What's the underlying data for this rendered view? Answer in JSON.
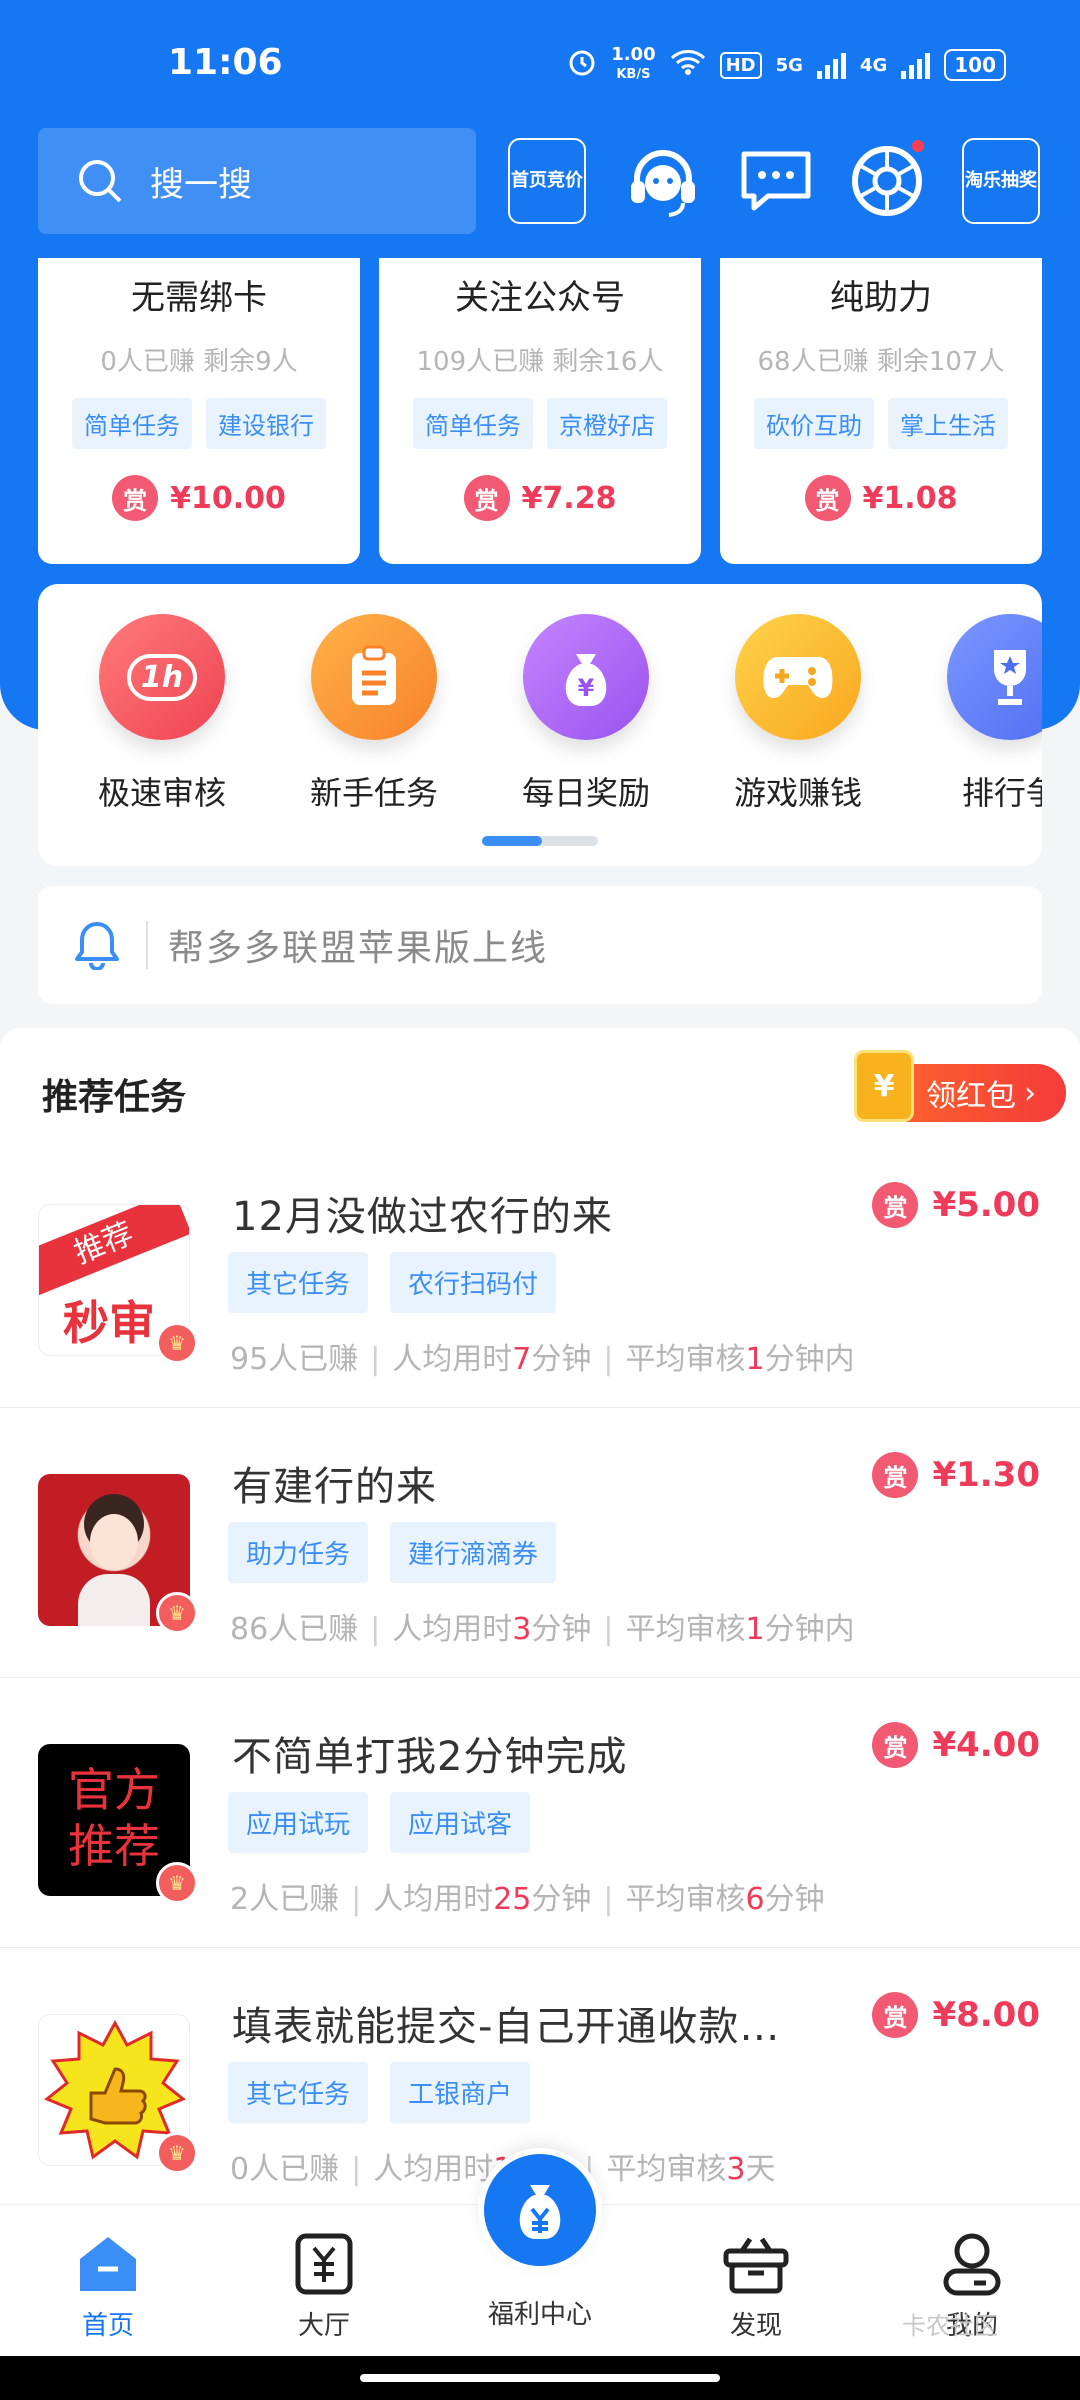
{
  "status_bar": {
    "time": "11:06",
    "speed_value": "1.00",
    "speed_unit": "KB/S",
    "hd": "HD",
    "net1": "5G",
    "net2": "4G",
    "battery": "100"
  },
  "header": {
    "search_placeholder": "搜一搜",
    "btn_home_bid": "首页竞价",
    "btn_lottery": "淘乐抽奖"
  },
  "top_cards": [
    {
      "title": "无需绑卡",
      "stats": "0人已赚  剩余9人",
      "tags": [
        "简单任务",
        "建设银行"
      ],
      "badge": "赏",
      "price": "¥10.00"
    },
    {
      "title": "关注公众号",
      "stats": "109人已赚  剩余16人",
      "tags": [
        "简单任务",
        "京橙好店"
      ],
      "badge": "赏",
      "price": "¥7.28"
    },
    {
      "title": "纯助力",
      "stats": "68人已赚  剩余107人",
      "tags": [
        "砍价互助",
        "掌上生活"
      ],
      "badge": "赏",
      "price": "¥1.08"
    }
  ],
  "categories": [
    {
      "label": "极速审核",
      "icon_text": "1h",
      "color": "#f0545d"
    },
    {
      "label": "新手任务",
      "icon_text": "",
      "color": "#f98a2a"
    },
    {
      "label": "每日奖励",
      "icon_text": "¥",
      "color": "#a35cf0"
    },
    {
      "label": "游戏赚钱",
      "icon_text": "",
      "color": "#f8b020"
    },
    {
      "label": "排行争",
      "icon_text": "",
      "color": "#5a7bf6"
    }
  ],
  "notice": {
    "text": "帮多多联盟苹果版上线"
  },
  "recommend": {
    "title": "推荐任务",
    "hongbao": "领红包",
    "hongbao_coin": "¥",
    "tasks": [
      {
        "title": "12月没做过农行的来",
        "badge": "赏",
        "price": "¥5.00",
        "tags": [
          "其它任务",
          "农行扫码付"
        ],
        "earned": "95人已赚",
        "avg_time_prefix": "人均用时",
        "avg_time_num": "7",
        "avg_time_unit": "分钟",
        "review_prefix": "平均审核",
        "review_num": "1",
        "review_unit": "分钟内",
        "thumb_text1": "推荐",
        "thumb_text2": "秒审"
      },
      {
        "title": "有建行的来",
        "badge": "赏",
        "price": "¥1.30",
        "tags": [
          "助力任务",
          "建行滴滴券"
        ],
        "earned": "86人已赚",
        "avg_time_prefix": "人均用时",
        "avg_time_num": "3",
        "avg_time_unit": "分钟",
        "review_prefix": "平均审核",
        "review_num": "1",
        "review_unit": "分钟内",
        "thumb_text1": "",
        "thumb_text2": ""
      },
      {
        "title": "不简单打我2分钟完成",
        "badge": "赏",
        "price": "¥4.00",
        "tags": [
          "应用试玩",
          "应用试客"
        ],
        "earned": "2人已赚",
        "avg_time_prefix": "人均用时",
        "avg_time_num": "25",
        "avg_time_unit": "分钟",
        "review_prefix": "平均审核",
        "review_num": "6",
        "review_unit": "分钟",
        "thumb_text1": "官方",
        "thumb_text2": "推荐"
      },
      {
        "title": "填表就能提交-自己开通收款…",
        "badge": "赏",
        "price": "¥8.00",
        "tags": [
          "其它任务",
          "工银商户"
        ],
        "earned": "0人已赚",
        "avg_time_prefix": "人均用时",
        "avg_time_num": "1",
        "avg_time_unit": "小时",
        "review_prefix": "平均审核",
        "review_num": "3",
        "review_unit": "天",
        "thumb_text1": "",
        "thumb_text2": ""
      }
    ]
  },
  "bottom_nav": {
    "home": "首页",
    "hall": "大厅",
    "welfare": "福利中心",
    "discover": "发现",
    "mine": "我的",
    "watermark": "卡农社区"
  }
}
